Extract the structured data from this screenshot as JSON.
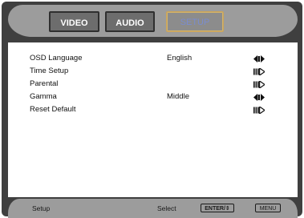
{
  "tabs": [
    {
      "label": "VIDEO",
      "active": false
    },
    {
      "label": "AUDIO",
      "active": false
    },
    {
      "label": "SETUP",
      "active": true
    }
  ],
  "menu": {
    "items": [
      {
        "label": "OSD Language",
        "value": "English",
        "icon": "left-right-arrows-icon"
      },
      {
        "label": "Time Setup",
        "value": "",
        "icon": "enter-arrow-icon"
      },
      {
        "label": "Parental",
        "value": "",
        "icon": "enter-arrow-icon"
      },
      {
        "label": "Gamma",
        "value": "Middle",
        "icon": "left-right-arrows-icon"
      },
      {
        "label": "Reset Default",
        "value": "",
        "icon": "enter-arrow-icon"
      }
    ]
  },
  "footer": {
    "section_label": "Setup",
    "select_label": "Select",
    "nav_key_label": "ENTER/⇕",
    "menu_key_label": "MENU"
  },
  "colors": {
    "frame": "#3f3f3f",
    "bar": "#9c9c9c",
    "active_tab_text": "#7a8ccf",
    "active_tab_border": "#c9a35a"
  }
}
